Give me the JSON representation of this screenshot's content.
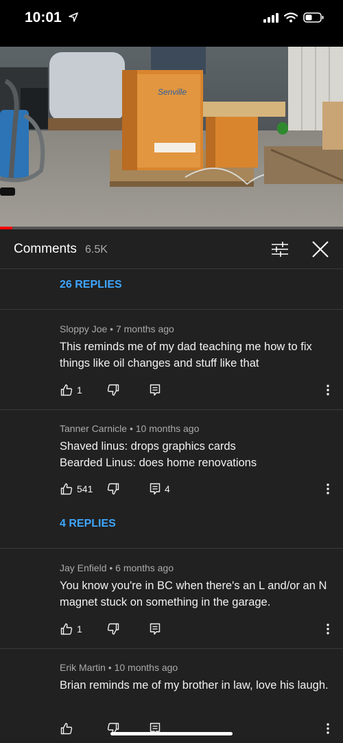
{
  "status_bar": {
    "time": "10:01"
  },
  "video": {
    "progress_percent": 3.5
  },
  "header": {
    "title": "Comments",
    "count": "6.5K"
  },
  "top_replies_link": "26 REPLIES",
  "comments": [
    {
      "author": "Sloppy Joe",
      "age": "7 months ago",
      "text": "This reminds me of my dad teaching me how to fix things like oil changes and stuff like that",
      "likes": "1",
      "reply_count": ""
    },
    {
      "author": "Tanner Carnicle",
      "age": "10 months ago",
      "text": "Shaved linus: drops graphics cards\nBearded Linus: does home renovations",
      "likes": "541",
      "reply_count": "4",
      "replies_link": "4 REPLIES"
    },
    {
      "author": "Jay Enfield",
      "age": "6 months ago",
      "text": "You know you're in BC when there's an L and/or an N magnet stuck on something in the garage.",
      "likes": "1",
      "reply_count": ""
    },
    {
      "author": "Erik Martin",
      "age": "10 months ago",
      "text": "Brian reminds me of my brother in law, love his laugh.",
      "likes": "",
      "reply_count": ""
    }
  ],
  "icons": {
    "like": "thumbs-up-icon",
    "dislike": "thumbs-down-icon",
    "reply": "reply-comment-icon",
    "more": "more-vertical-icon",
    "filter": "sort-filter-icon",
    "close": "close-icon"
  },
  "colors": {
    "accent": "#3ea6ff",
    "progress": "#ff0000",
    "background": "#212121"
  }
}
